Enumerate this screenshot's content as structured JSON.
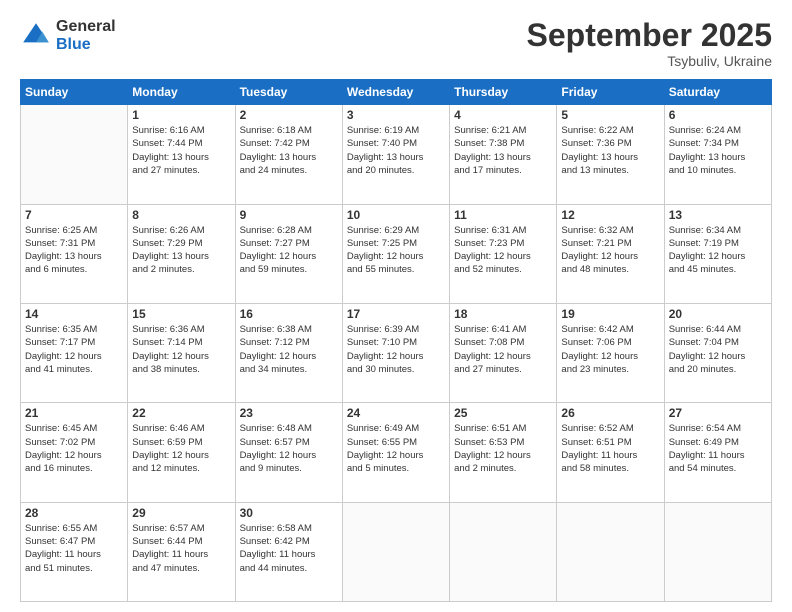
{
  "header": {
    "logo_general": "General",
    "logo_blue": "Blue",
    "month": "September 2025",
    "location": "Tsybuliv, Ukraine"
  },
  "days_of_week": [
    "Sunday",
    "Monday",
    "Tuesday",
    "Wednesday",
    "Thursday",
    "Friday",
    "Saturday"
  ],
  "weeks": [
    [
      {
        "day": "",
        "info": ""
      },
      {
        "day": "1",
        "info": "Sunrise: 6:16 AM\nSunset: 7:44 PM\nDaylight: 13 hours\nand 27 minutes."
      },
      {
        "day": "2",
        "info": "Sunrise: 6:18 AM\nSunset: 7:42 PM\nDaylight: 13 hours\nand 24 minutes."
      },
      {
        "day": "3",
        "info": "Sunrise: 6:19 AM\nSunset: 7:40 PM\nDaylight: 13 hours\nand 20 minutes."
      },
      {
        "day": "4",
        "info": "Sunrise: 6:21 AM\nSunset: 7:38 PM\nDaylight: 13 hours\nand 17 minutes."
      },
      {
        "day": "5",
        "info": "Sunrise: 6:22 AM\nSunset: 7:36 PM\nDaylight: 13 hours\nand 13 minutes."
      },
      {
        "day": "6",
        "info": "Sunrise: 6:24 AM\nSunset: 7:34 PM\nDaylight: 13 hours\nand 10 minutes."
      }
    ],
    [
      {
        "day": "7",
        "info": "Sunrise: 6:25 AM\nSunset: 7:31 PM\nDaylight: 13 hours\nand 6 minutes."
      },
      {
        "day": "8",
        "info": "Sunrise: 6:26 AM\nSunset: 7:29 PM\nDaylight: 13 hours\nand 2 minutes."
      },
      {
        "day": "9",
        "info": "Sunrise: 6:28 AM\nSunset: 7:27 PM\nDaylight: 12 hours\nand 59 minutes."
      },
      {
        "day": "10",
        "info": "Sunrise: 6:29 AM\nSunset: 7:25 PM\nDaylight: 12 hours\nand 55 minutes."
      },
      {
        "day": "11",
        "info": "Sunrise: 6:31 AM\nSunset: 7:23 PM\nDaylight: 12 hours\nand 52 minutes."
      },
      {
        "day": "12",
        "info": "Sunrise: 6:32 AM\nSunset: 7:21 PM\nDaylight: 12 hours\nand 48 minutes."
      },
      {
        "day": "13",
        "info": "Sunrise: 6:34 AM\nSunset: 7:19 PM\nDaylight: 12 hours\nand 45 minutes."
      }
    ],
    [
      {
        "day": "14",
        "info": "Sunrise: 6:35 AM\nSunset: 7:17 PM\nDaylight: 12 hours\nand 41 minutes."
      },
      {
        "day": "15",
        "info": "Sunrise: 6:36 AM\nSunset: 7:14 PM\nDaylight: 12 hours\nand 38 minutes."
      },
      {
        "day": "16",
        "info": "Sunrise: 6:38 AM\nSunset: 7:12 PM\nDaylight: 12 hours\nand 34 minutes."
      },
      {
        "day": "17",
        "info": "Sunrise: 6:39 AM\nSunset: 7:10 PM\nDaylight: 12 hours\nand 30 minutes."
      },
      {
        "day": "18",
        "info": "Sunrise: 6:41 AM\nSunset: 7:08 PM\nDaylight: 12 hours\nand 27 minutes."
      },
      {
        "day": "19",
        "info": "Sunrise: 6:42 AM\nSunset: 7:06 PM\nDaylight: 12 hours\nand 23 minutes."
      },
      {
        "day": "20",
        "info": "Sunrise: 6:44 AM\nSunset: 7:04 PM\nDaylight: 12 hours\nand 20 minutes."
      }
    ],
    [
      {
        "day": "21",
        "info": "Sunrise: 6:45 AM\nSunset: 7:02 PM\nDaylight: 12 hours\nand 16 minutes."
      },
      {
        "day": "22",
        "info": "Sunrise: 6:46 AM\nSunset: 6:59 PM\nDaylight: 12 hours\nand 12 minutes."
      },
      {
        "day": "23",
        "info": "Sunrise: 6:48 AM\nSunset: 6:57 PM\nDaylight: 12 hours\nand 9 minutes."
      },
      {
        "day": "24",
        "info": "Sunrise: 6:49 AM\nSunset: 6:55 PM\nDaylight: 12 hours\nand 5 minutes."
      },
      {
        "day": "25",
        "info": "Sunrise: 6:51 AM\nSunset: 6:53 PM\nDaylight: 12 hours\nand 2 minutes."
      },
      {
        "day": "26",
        "info": "Sunrise: 6:52 AM\nSunset: 6:51 PM\nDaylight: 11 hours\nand 58 minutes."
      },
      {
        "day": "27",
        "info": "Sunrise: 6:54 AM\nSunset: 6:49 PM\nDaylight: 11 hours\nand 54 minutes."
      }
    ],
    [
      {
        "day": "28",
        "info": "Sunrise: 6:55 AM\nSunset: 6:47 PM\nDaylight: 11 hours\nand 51 minutes."
      },
      {
        "day": "29",
        "info": "Sunrise: 6:57 AM\nSunset: 6:44 PM\nDaylight: 11 hours\nand 47 minutes."
      },
      {
        "day": "30",
        "info": "Sunrise: 6:58 AM\nSunset: 6:42 PM\nDaylight: 11 hours\nand 44 minutes."
      },
      {
        "day": "",
        "info": ""
      },
      {
        "day": "",
        "info": ""
      },
      {
        "day": "",
        "info": ""
      },
      {
        "day": "",
        "info": ""
      }
    ]
  ]
}
